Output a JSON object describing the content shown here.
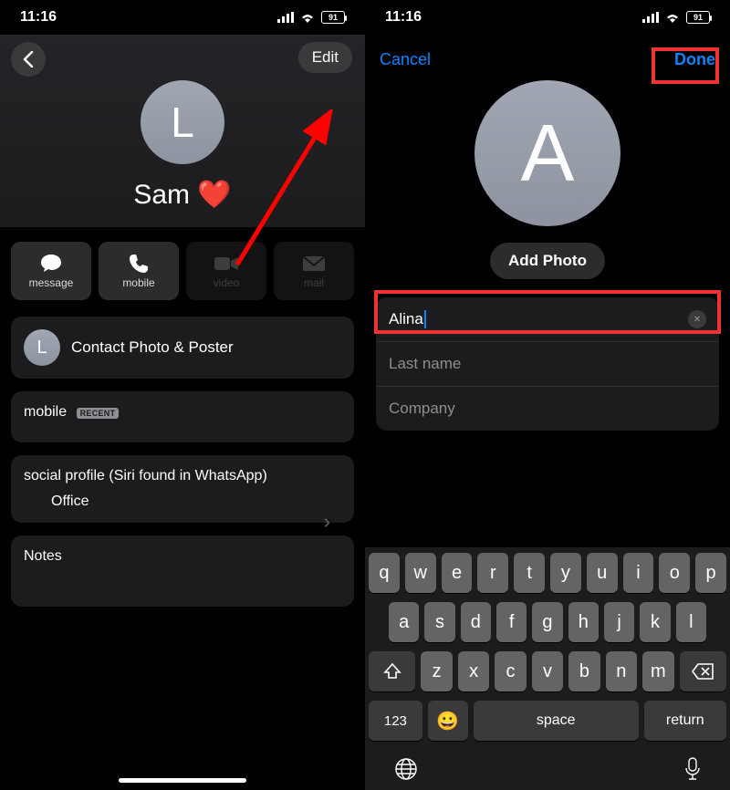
{
  "status": {
    "time": "11:16",
    "battery": "91"
  },
  "left": {
    "edit": "Edit",
    "avatar_letter": "L",
    "name": "Sam ❤️",
    "actions": {
      "message": "message",
      "mobile": "mobile",
      "video": "video",
      "mail": "mail"
    },
    "photo_poster": "Contact Photo & Poster",
    "photo_poster_letter": "L",
    "mobile_label": "mobile",
    "mobile_badge": "RECENT",
    "social_title": "social profile (Siri found in WhatsApp)",
    "social_value": "Office",
    "notes_label": "Notes"
  },
  "right": {
    "cancel": "Cancel",
    "done": "Done",
    "avatar_letter": "A",
    "add_photo": "Add Photo",
    "first_name_value": "Alina",
    "last_name_placeholder": "Last name",
    "company_placeholder": "Company"
  },
  "keyboard": {
    "row1": [
      "q",
      "w",
      "e",
      "r",
      "t",
      "y",
      "u",
      "i",
      "o",
      "p"
    ],
    "row2": [
      "a",
      "s",
      "d",
      "f",
      "g",
      "h",
      "j",
      "k",
      "l"
    ],
    "row3": [
      "z",
      "x",
      "c",
      "v",
      "b",
      "n",
      "m"
    ],
    "mode": "123",
    "space": "space",
    "return": "return"
  }
}
